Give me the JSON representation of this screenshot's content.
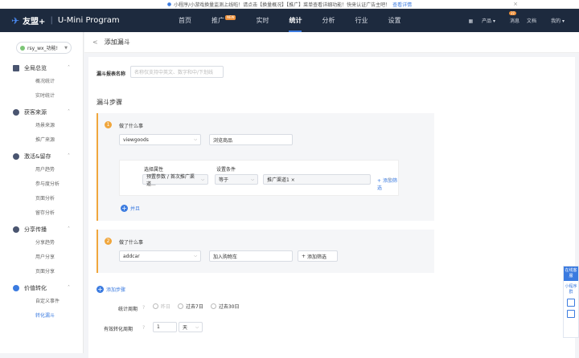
{
  "notice": {
    "text": "小程序/小游戏换量监测上线啦！请点击【换量概况】【推广】菜单查看详细功能！快来认证广告主吧！",
    "link": "查看详情",
    "close": "×"
  },
  "topbar": {
    "logo_icon": "✈",
    "logo": "友盟+",
    "product": "U-Mini Program",
    "nav": [
      {
        "label": "首页"
      },
      {
        "label": "推广",
        "tag": "NEW"
      },
      {
        "label": "实时"
      },
      {
        "label": "统计",
        "active": true
      },
      {
        "label": "分析"
      },
      {
        "label": "行业"
      },
      {
        "label": "设置"
      }
    ],
    "products": "产品",
    "messages": "消息",
    "msg_count": "31",
    "docs": "文档",
    "me": "我的"
  },
  "sidebar": {
    "app": "rsy_wx_功能!",
    "groups": [
      {
        "title": "全局总览",
        "items": [
          "概况统计",
          "实时统计"
        ]
      },
      {
        "title": "获客来源",
        "items": [
          "场景来源",
          "推广来源"
        ]
      },
      {
        "title": "激活&留存",
        "items": [
          "用户趋势",
          "参与度分析",
          "页面分析",
          "留存分析"
        ]
      },
      {
        "title": "分享传播",
        "items": [
          "分享趋势",
          "用户分享",
          "页面分享"
        ]
      },
      {
        "title": "价值转化",
        "items": [
          "自定义事件",
          "转化漏斗"
        ]
      }
    ]
  },
  "page": {
    "back": "<",
    "title": "添加漏斗",
    "report_name_label": "漏斗报表名称",
    "report_name_placeholder": "名称仅支持中英文、数字和中/下划线",
    "steps_title": "漏斗步骤",
    "step1": {
      "num": "1",
      "title": "做了什么事",
      "event": "viewgoods",
      "event_name": "浏览商品",
      "attr_label": "选择属性",
      "cond_label": "设置条件",
      "attr_value": "预置参数 / 首次推广渠道...",
      "cond_value": "等于",
      "filter_value": "推广渠道1 ×",
      "add_filter": "添加筛选",
      "and_label": "并且"
    },
    "step2": {
      "num": "2",
      "title": "做了什么事",
      "event": "addcar",
      "event_name": "加入购物车",
      "add_filter": "添加筛选"
    },
    "add_step": "添加步骤",
    "period_label": "统计周期",
    "period_options": [
      "昨日",
      "过去7日",
      "过去30日"
    ],
    "valid_label": "有效转化周期",
    "valid_value": "1",
    "valid_unit": "天"
  },
  "float": {
    "top": "在线客服",
    "item": "小程序群"
  }
}
